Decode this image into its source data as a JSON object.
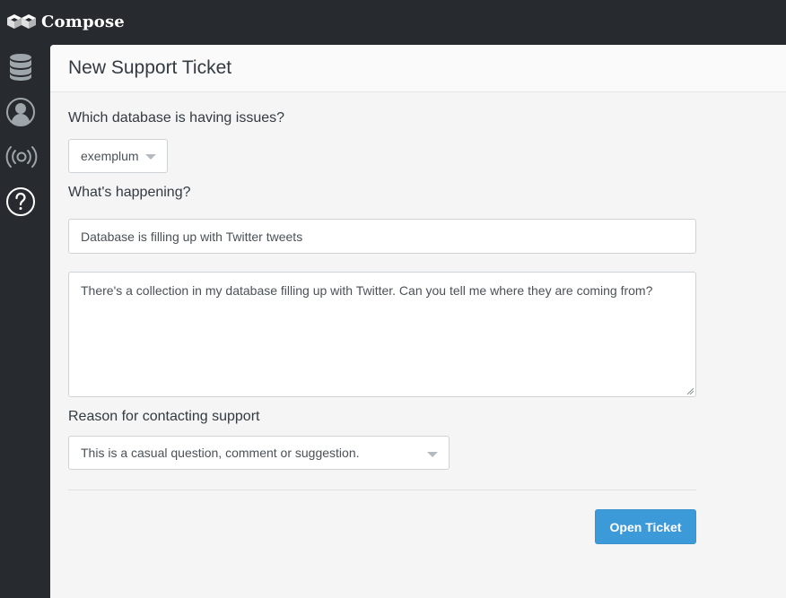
{
  "app": {
    "name": "Compose"
  },
  "sidebar": {
    "items": [
      {
        "icon": "database-icon",
        "label": "Databases"
      },
      {
        "icon": "user-icon",
        "label": "Account"
      },
      {
        "icon": "broadcast-icon",
        "label": "Status"
      },
      {
        "icon": "help-icon",
        "label": "Support"
      }
    ]
  },
  "page": {
    "title": "New Support Ticket"
  },
  "form": {
    "database_label": "Which database is having issues?",
    "database_value": "exemplum",
    "happening_label": "What's happening?",
    "subject_value": "Database is filling up with Twitter tweets",
    "body_value": "There's a collection in my database filling up with Twitter. Can you tell me where they are coming from?",
    "reason_label": "Reason for contacting support",
    "reason_value": "This is a casual question, comment or suggestion.",
    "submit_label": "Open Ticket"
  },
  "colors": {
    "chrome": "#272b30",
    "content_bg": "#f4f5f4",
    "primary": "#3d9ad9",
    "sidebar_icon": "#9ea5ab"
  }
}
